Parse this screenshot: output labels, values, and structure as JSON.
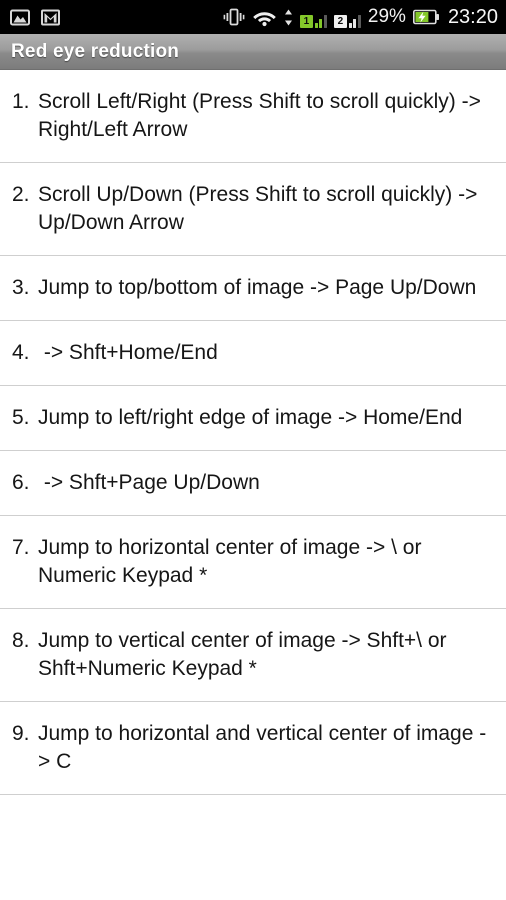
{
  "status_bar": {
    "left_icons": [
      {
        "name": "gallery-icon",
        "label": "gallery"
      },
      {
        "name": "gmail-icon",
        "label": "gmail"
      }
    ],
    "right_icons": [
      {
        "name": "vibrate-icon",
        "label": "vibrate"
      },
      {
        "name": "wifi-icon",
        "label": "wifi"
      },
      {
        "name": "data-transfer-icon",
        "label": "data up/down"
      }
    ],
    "sim1_label": "1",
    "sim2_label": "2",
    "battery_percent": "29%",
    "battery_state": "charging",
    "clock": "23:20",
    "background_color": "#000000",
    "text_color": "#f2f2f2",
    "accent_color": "#84c82a"
  },
  "title_bar": {
    "title": "Red eye reduction",
    "background_top": "#b0b0b0",
    "background_bottom": "#7c7c7c",
    "text_color": "#ffffff"
  },
  "list": {
    "items": [
      {
        "number": "1.",
        "text": "Scroll Left/Right (Press Shift to scroll quickly) -> Right/Left Arrow"
      },
      {
        "number": "2.",
        "text": "Scroll Up/Down (Press Shift to scroll quickly) -> Up/Down Arrow"
      },
      {
        "number": "3.",
        "text": "Jump to top/bottom of image -> Page Up/Down"
      },
      {
        "number": "4.",
        "text": " -> Shft+Home/End"
      },
      {
        "number": "5.",
        "text": "Jump to left/right edge of image -> Home/End"
      },
      {
        "number": "6.",
        "text": " -> Shft+Page Up/Down"
      },
      {
        "number": "7.",
        "text": "Jump to horizontal center of image -> \\ or Numeric Keypad *"
      },
      {
        "number": "8.",
        "text": "Jump to vertical center of image -> Shft+\\ or Shft+Numeric Keypad *"
      },
      {
        "number": "9.",
        "text": "Jump to horizontal and vertical center of image -> C"
      }
    ],
    "divider_color": "#cfcfcf",
    "text_color": "#161616"
  }
}
